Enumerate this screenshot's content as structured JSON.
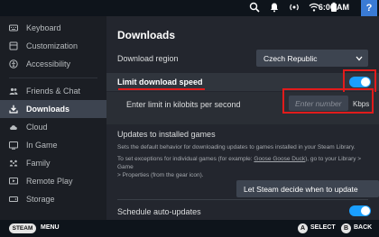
{
  "statusbar": {
    "time": "6:06 AM",
    "help_label": "?",
    "icons": [
      "search-icon",
      "notifications-icon",
      "broadcast-icon",
      "wifi-icon",
      "battery-icon"
    ]
  },
  "sidebar": {
    "items": [
      {
        "label": "Keyboard",
        "icon": "keyboard-icon",
        "active": false
      },
      {
        "label": "Customization",
        "icon": "customization-icon",
        "active": false
      },
      {
        "label": "Accessibility",
        "icon": "accessibility-icon",
        "active": false
      },
      {
        "label": "Friends & Chat",
        "icon": "friends-icon",
        "active": false
      },
      {
        "label": "Downloads",
        "icon": "download-icon",
        "active": true
      },
      {
        "label": "Cloud",
        "icon": "cloud-icon",
        "active": false
      },
      {
        "label": "In Game",
        "icon": "in-game-icon",
        "active": false
      },
      {
        "label": "Family",
        "icon": "family-icon",
        "active": false
      },
      {
        "label": "Remote Play",
        "icon": "remote-play-icon",
        "active": false
      },
      {
        "label": "Storage",
        "icon": "storage-icon",
        "active": false
      }
    ]
  },
  "main": {
    "title": "Downloads",
    "download_region": {
      "label": "Download region",
      "value": "Czech Republic"
    },
    "limit_speed": {
      "label": "Limit download speed",
      "enabled": true
    },
    "limit_input": {
      "label": "Enter limit in kilobits per second",
      "placeholder": "Enter number",
      "unit": "Kbps"
    },
    "updates": {
      "heading": "Updates to installed games",
      "desc1": "Sets the default behavior for downloading updates to games installed in your Steam Library.",
      "desc2_a": "To set exceptions for individual games (for example: ",
      "desc2_link": "Goose Goose Duck",
      "desc2_b": "), go to your Library > Game",
      "desc2_c": "> Properties (from the gear icon).",
      "dropdown_value": "Let Steam decide when to update"
    },
    "schedule": {
      "label": "Schedule auto-updates",
      "enabled": true
    }
  },
  "bottombar": {
    "steam_label": "STEAM",
    "menu_label": "MENU",
    "a_key": "A",
    "a_label": "SELECT",
    "b_key": "B",
    "b_label": "BACK"
  },
  "colors": {
    "accent": "#1a9fff",
    "annotation_red": "#e11b1b",
    "sidebar_bg": "#1b1e24",
    "main_bg": "#23262e"
  }
}
